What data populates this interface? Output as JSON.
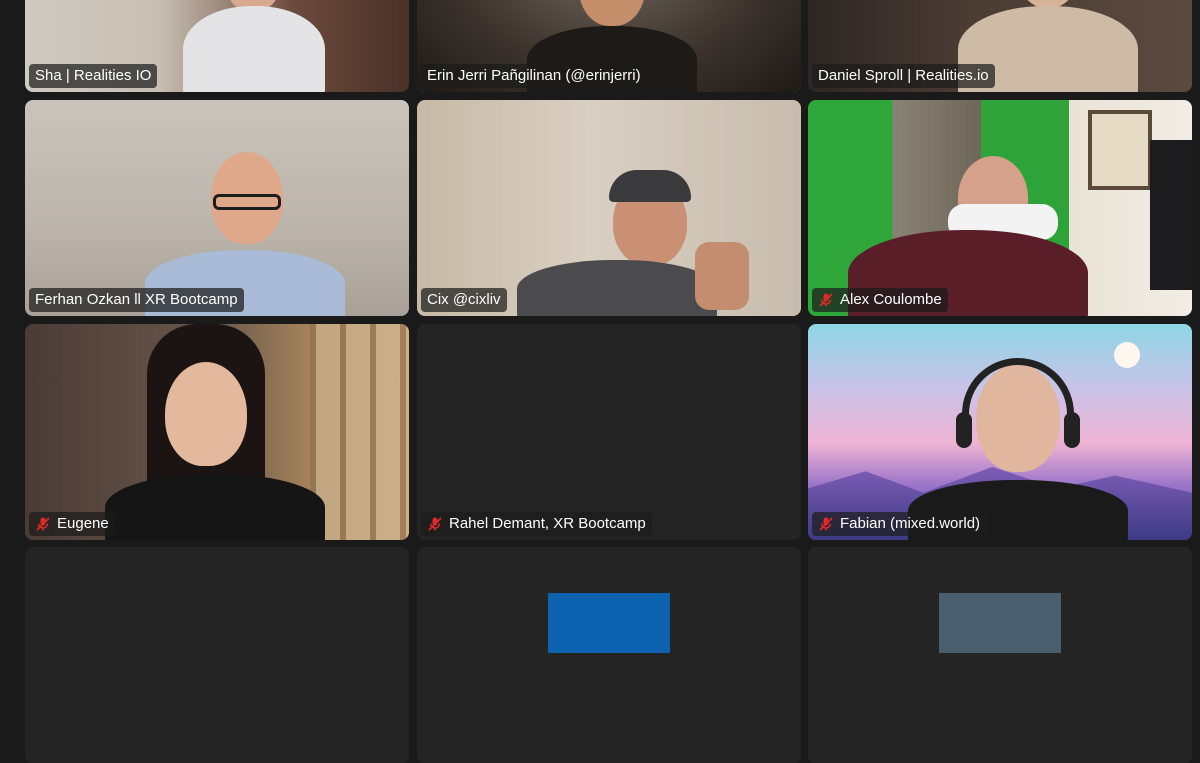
{
  "participants": [
    {
      "name": "Sha | Realities IO",
      "muted": false
    },
    {
      "name": "Erin Jerri Pañgilinan (@erinjerri)",
      "muted": false,
      "active_speaker": true
    },
    {
      "name": "Daniel Sproll | Realities.io",
      "muted": false
    },
    {
      "name": "Ferhan Ozkan ll XR Bootcamp",
      "muted": false
    },
    {
      "name": "Cix @cixliv",
      "muted": false
    },
    {
      "name": "Alex Coulombe",
      "muted": true
    },
    {
      "name": "Eugene",
      "muted": true
    },
    {
      "name": "Rahel Demant, XR Bootcamp",
      "muted": true
    },
    {
      "name": "Fabian (mixed.world)",
      "muted": true
    },
    {
      "name": "",
      "muted": false
    },
    {
      "name": "",
      "muted": false
    },
    {
      "name": "",
      "muted": false
    }
  ],
  "icons": {
    "mute": "microphone-muted-icon"
  },
  "colors": {
    "background": "#1a1a1a",
    "tile": "#242424",
    "active_border": "#3ccd5a",
    "mute_red": "#e02828",
    "avatar_blue": "#0d63b0",
    "avatar_slate": "#4a5f6d"
  }
}
